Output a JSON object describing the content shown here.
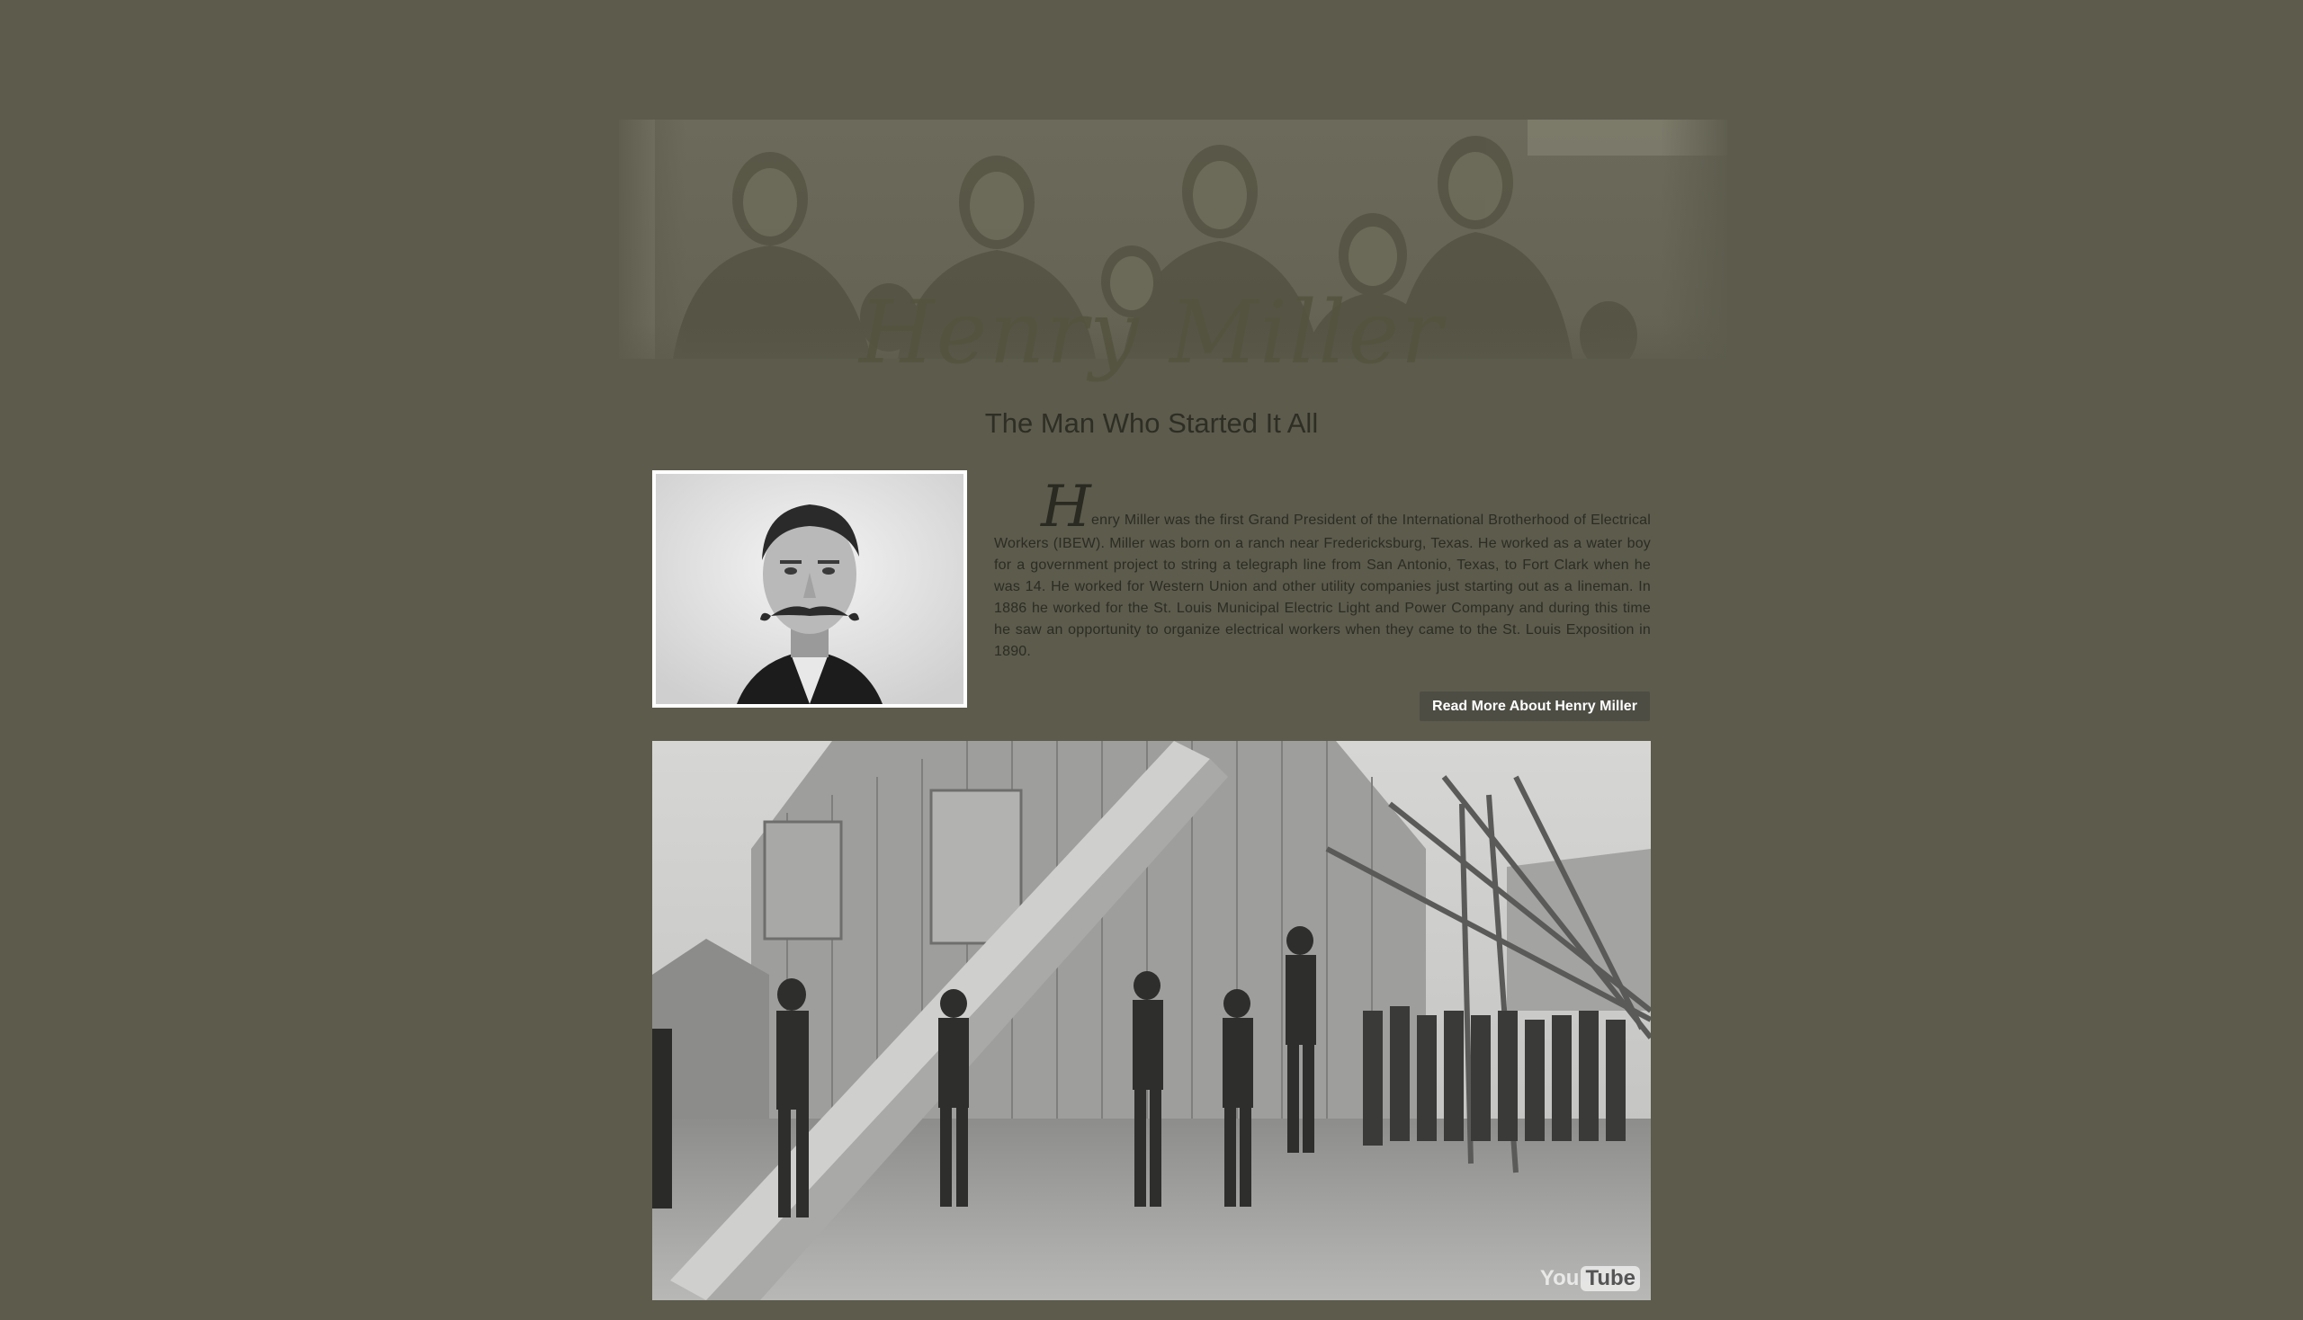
{
  "colors": {
    "background": "#5c5b4c",
    "button": "#4e4d44",
    "text": "#2c2c24"
  },
  "header": {
    "banner_alt": "group photo of IBEW founders",
    "title": "Henry Miller",
    "subtitle": "The Man Who Started It All"
  },
  "bio": {
    "portrait_alt": "portrait of Henry Miller",
    "dropcap": "H",
    "text": "enry Miller was the first Grand President of the International Brotherhood of Electrical Workers (IBEW). Miller was born on a ranch near Fredericksburg, Texas. He worked as a water boy for a government project to string a telegraph line from San Antonio, Texas, to Fort Clark when he was 14. He worked for Western Union and other utility companies just starting out as a lineman. In 1886 he worked for the St. Louis Municipal Electric Light and Power Company and during this time he saw an opportunity to organize electrical workers when they came to the St. Louis Exposition in 1890.",
    "button_label": "Read More About Henry Miller"
  },
  "video": {
    "thumbnail_alt": "historic photo of linemen raising a utility pole",
    "logo_you": "You",
    "logo_tube": "Tube"
  }
}
